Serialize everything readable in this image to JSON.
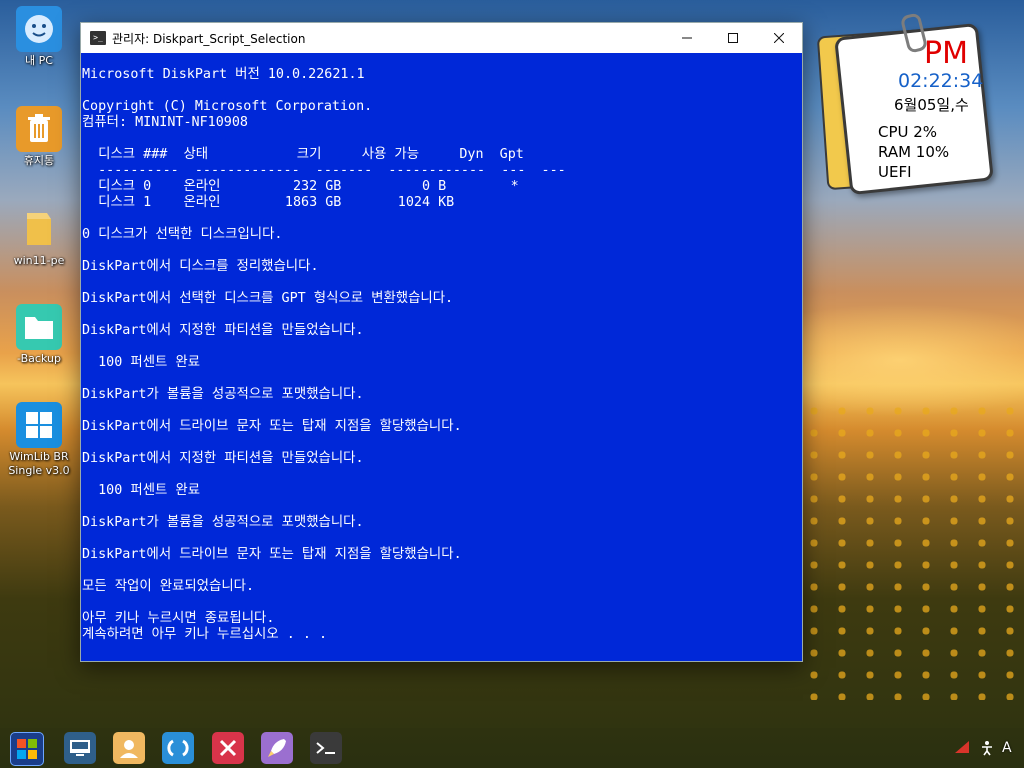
{
  "desktop": {
    "icons": [
      {
        "label": "내 PC",
        "icon": "monitor-face-icon"
      },
      {
        "label": "휴지통",
        "icon": "recycle-bin-icon"
      },
      {
        "label": "win11-pe",
        "icon": "folder-icon"
      },
      {
        "label": "-Backup",
        "icon": "folder-teal-icon"
      },
      {
        "label": "WimLib BR Single v3.0",
        "icon": "windows-logo-icon"
      }
    ]
  },
  "console": {
    "title": "관리자:  Diskpart_Script_Selection",
    "icon": "terminal-icon",
    "bg_color": "#0028d8",
    "lines": [
      "Microsoft DiskPart 버전 10.0.22621.1",
      "",
      "Copyright (C) Microsoft Corporation.",
      "컴퓨터: MININT-NF10908",
      "",
      "  디스크 ###  상태           크기     사용 가능     Dyn  Gpt",
      "  ----------  -------------  -------  ------------  ---  ---",
      "  디스크 0    온라인         232 GB          0 B        *",
      "  디스크 1    온라인        1863 GB       1024 KB",
      "",
      "0 디스크가 선택한 디스크입니다.",
      "",
      "DiskPart에서 디스크를 정리했습니다.",
      "",
      "DiskPart에서 선택한 디스크를 GPT 형식으로 변환했습니다.",
      "",
      "DiskPart에서 지정한 파티션을 만들었습니다.",
      "",
      "  100 퍼센트 완료",
      "",
      "DiskPart가 볼륨을 성공적으로 포맷했습니다.",
      "",
      "DiskPart에서 드라이브 문자 또는 탑재 지점을 할당했습니다.",
      "",
      "DiskPart에서 지정한 파티션을 만들었습니다.",
      "",
      "  100 퍼센트 완료",
      "",
      "DiskPart가 볼륨을 성공적으로 포맷했습니다.",
      "",
      "DiskPart에서 드라이브 문자 또는 탑재 지점을 할당했습니다.",
      "",
      "모든 작업이 완료되었습니다.",
      "",
      "아무 키나 누르시면 종료됩니다.",
      "계속하려면 아무 키나 누르십시오 . . ."
    ]
  },
  "clock_widget": {
    "ampm": "PM",
    "time": "02:22:34",
    "date": "6월05일,수",
    "cpu": "CPU  2%",
    "ram": "RAM  10%",
    "boot": "UEFI"
  },
  "taskbar": {
    "apps": [
      "start-icon",
      "desktop-icon",
      "user-icon",
      "refresh-icon",
      "x-app-icon",
      "rocket-icon",
      "terminal-icon"
    ],
    "tray_ime": "A"
  }
}
